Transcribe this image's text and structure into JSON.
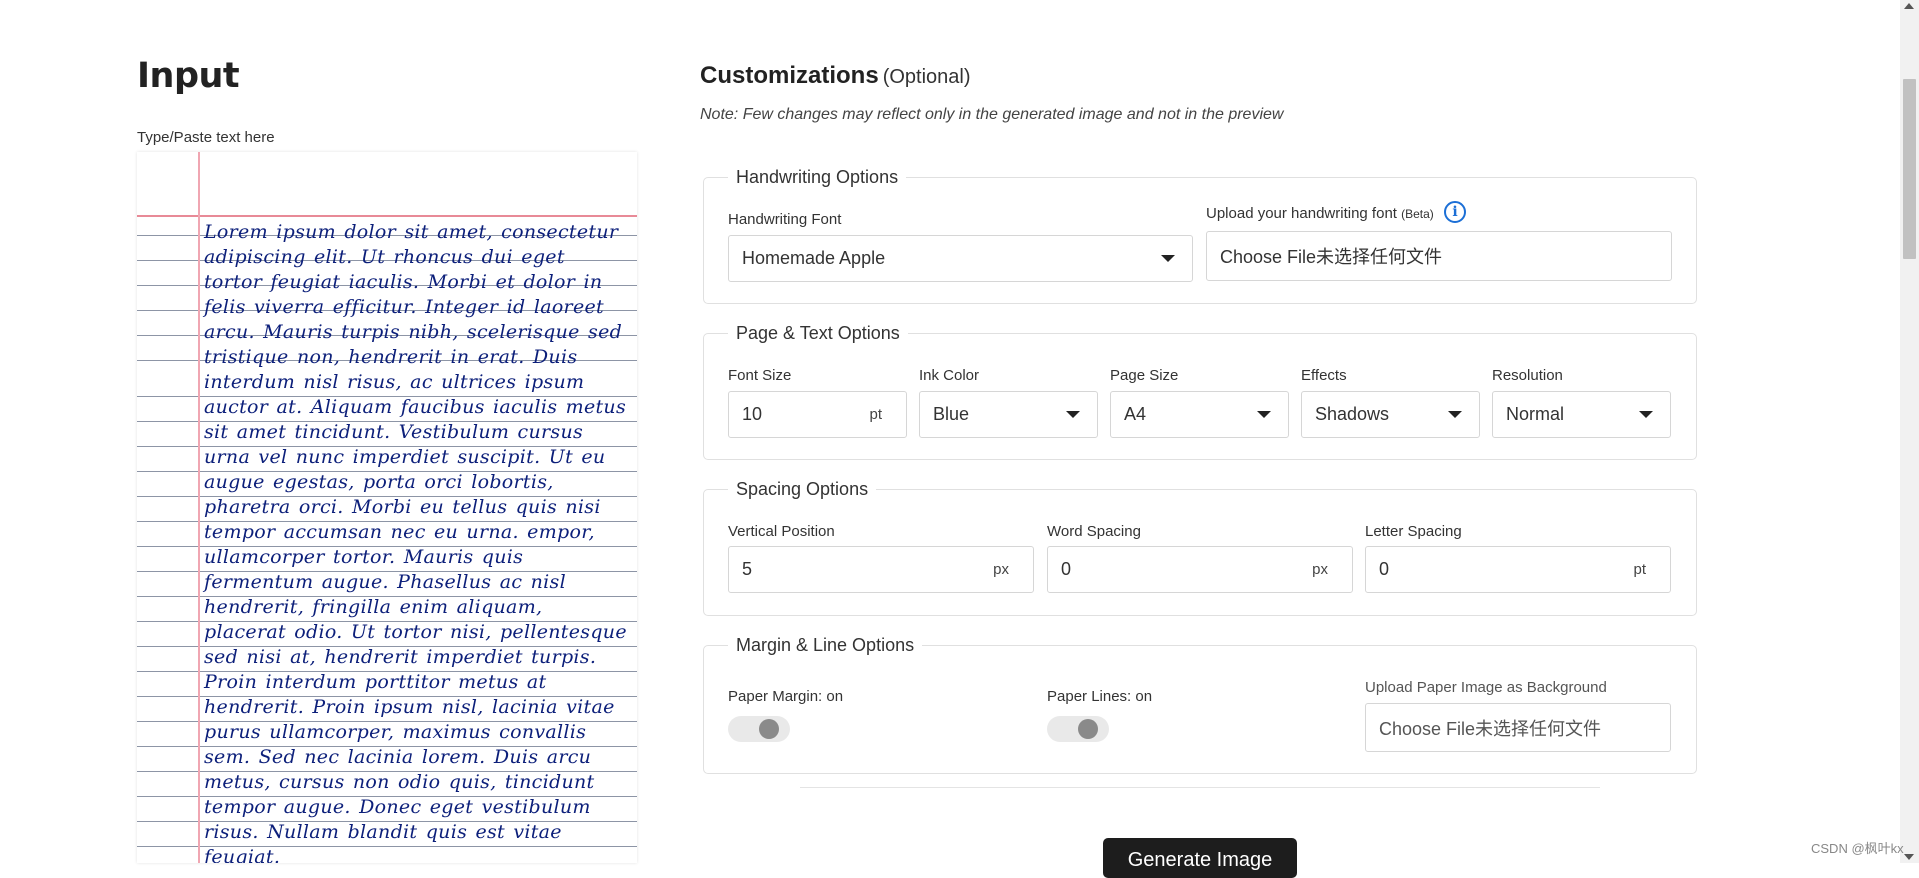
{
  "input": {
    "title": "Input",
    "label": "Type/Paste text here",
    "text": "Lorem ipsum dolor sit amet, consectetur adipiscing elit. Ut rhoncus dui eget tortor feugiat iaculis. Morbi et dolor in felis viverra efficitur. Integer id laoreet arcu. Mauris turpis nibh, scelerisque sed tristique non, hendrerit in erat. Duis interdum nisl risus, ac ultrices ipsum auctor at. Aliquam faucibus iaculis metus sit amet tincidunt. Vestibulum cursus urna vel nunc imperdiet suscipit. Ut eu augue egestas, porta orci lobortis, pharetra orci. Morbi eu tellus quis nisi tempor accumsan nec eu urna. empor, ullamcorper tortor. Mauris quis fermentum augue. Phasellus ac nisl hendrerit, fringilla enim aliquam, placerat odio. Ut tortor nisi, pellentesque sed nisi at, hendrerit imperdiet turpis. Proin interdum porttitor metus at hendrerit. Proin ipsum nisl, lacinia vitae purus ullamcorper, maximus convallis sem. Sed nec lacinia lorem. Duis arcu metus, cursus non odio quis, tincidunt tempor augue. Donec eget vestibulum risus. Nullam blandit quis est vitae feugiat."
  },
  "customizations": {
    "title": "Customizations",
    "optional": "(Optional)",
    "note": "Note: Few changes may reflect only in the generated image and not in the preview"
  },
  "handwriting": {
    "legend": "Handwriting Options",
    "font_label": "Handwriting Font",
    "font_value": "Homemade Apple",
    "upload_label": "Upload your handwriting font",
    "upload_beta": "(Beta)",
    "upload_value": "Choose File未选择任何文件",
    "info_icon": "info-icon"
  },
  "page_text": {
    "legend": "Page & Text Options",
    "font_size_label": "Font Size",
    "font_size_value": "10",
    "font_size_unit": "pt",
    "ink_label": "Ink Color",
    "ink_value": "Blue",
    "page_size_label": "Page Size",
    "page_size_value": "A4",
    "effects_label": "Effects",
    "effects_value": "Shadows",
    "resolution_label": "Resolution",
    "resolution_value": "Normal"
  },
  "spacing": {
    "legend": "Spacing Options",
    "vertical_label": "Vertical Position",
    "vertical_value": "5",
    "vertical_unit": "px",
    "word_label": "Word Spacing",
    "word_value": "0",
    "word_unit": "px",
    "letter_label": "Letter Spacing",
    "letter_value": "0",
    "letter_unit": "pt"
  },
  "margin_line": {
    "legend": "Margin & Line Options",
    "margin_label": "Paper Margin: on",
    "lines_label": "Paper Lines: on",
    "upload_bg_label": "Upload Paper Image as Background",
    "upload_bg_value": "Choose File未选择任何文件"
  },
  "generate_button": "Generate Image",
  "watermark": "CSDN @枫叶kx",
  "colors": {
    "ink": "#0c1f7a",
    "margin_line": "#f0a6b2",
    "button_bg": "#1d1d1d",
    "info_icon": "#1c6fd6"
  }
}
